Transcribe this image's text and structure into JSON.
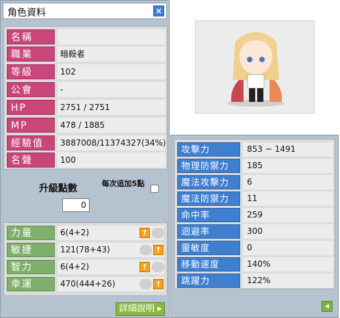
{
  "window": {
    "title": "角色資料",
    "close_icon": "close-icon"
  },
  "info_rows": [
    {
      "label": "名稱",
      "value": ""
    },
    {
      "label": "職業",
      "value": "暗殺者"
    },
    {
      "label": "等級",
      "value": "102"
    },
    {
      "label": "公會",
      "value": "-"
    },
    {
      "label": "HP",
      "value": "2751 / 2751"
    },
    {
      "label": "MP",
      "value": "478 / 1885"
    },
    {
      "label": "經驗值",
      "value": "3887008/11374327(34%)"
    },
    {
      "label": "名聲",
      "value": "100"
    }
  ],
  "ability_points": {
    "label": "升級點數",
    "value": "0",
    "bonus_label": "每次追加5點"
  },
  "stats": [
    {
      "label": "力量",
      "value": "6(4+2)"
    },
    {
      "label": "敏捷",
      "value": "121(78+43)"
    },
    {
      "label": "智力",
      "value": "6(4+2)"
    },
    {
      "label": "幸運",
      "value": "470(444+26)"
    }
  ],
  "detail_button": "詳細說明",
  "secondary_stats": [
    {
      "label": "攻擊力",
      "value": "853 ~ 1491"
    },
    {
      "label": "物理防禦力",
      "value": "185"
    },
    {
      "label": "魔法攻擊力",
      "value": "6"
    },
    {
      "label": "魔法防禦力",
      "value": "11"
    },
    {
      "label": "命中率",
      "value": "259"
    },
    {
      "label": "迴避率",
      "value": "300"
    },
    {
      "label": "靈敏度",
      "value": "0"
    },
    {
      "label": "移動速度",
      "value": "140%"
    },
    {
      "label": "跳躍力",
      "value": "122%"
    }
  ],
  "colors": {
    "info_label": "#c9467a",
    "stat_label": "#7fb06b",
    "secondary_label": "#3f7fd0",
    "panel_bg": "#b5c3d0"
  }
}
